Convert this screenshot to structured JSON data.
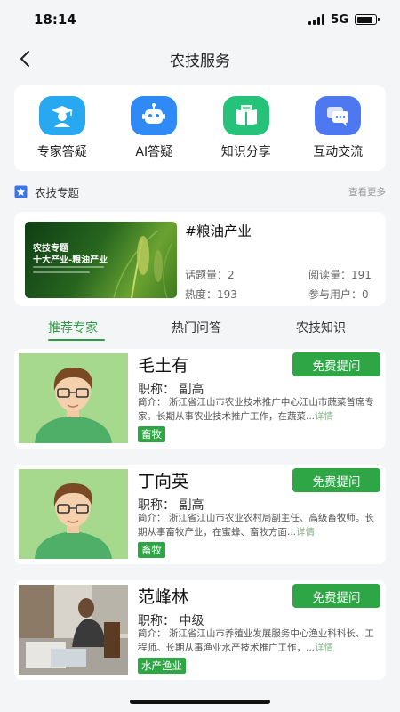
{
  "status_bar": {
    "time": "18:14",
    "network": "5G",
    "battery_level": 0.85
  },
  "nav": {
    "title": "农技服务"
  },
  "services": [
    {
      "label": "专家答疑",
      "icon": "expert-icon",
      "color": "#29a8f2"
    },
    {
      "label": "AI答疑",
      "icon": "robot-icon",
      "color": "#2f8af5"
    },
    {
      "label": "知识分享",
      "icon": "book-icon",
      "color": "#27c27a"
    },
    {
      "label": "互动交流",
      "icon": "chat-icon",
      "color": "#4e78f0"
    }
  ],
  "topics": {
    "title": "农技专题",
    "more": "查看更多",
    "card": {
      "banner_line1": "农技专题",
      "banner_line2": "十大产业-粮油产业",
      "name": "#粮油产业",
      "questions_label": "话题量：",
      "questions": "2",
      "reads_label": "阅读量：",
      "reads": "191",
      "heat_label": "热度：",
      "heat": "193",
      "users_label": "参与用户：",
      "users": "0"
    }
  },
  "tabs": [
    "推荐专家",
    "热门问答",
    "农技知识"
  ],
  "active_tab": 0,
  "ask_label": "免费提问",
  "title_label": "职称：",
  "intro_label": "简介：",
  "detail_label": "详情",
  "experts": [
    {
      "name": "毛土有",
      "title": "副高",
      "intro": "浙江省江山市农业技术推广中心江山市蔬菜首席专家。长期从事农业技术推广工作，在蔬菜...",
      "tag": "畜牧"
    },
    {
      "name": "丁向英",
      "title": "副高",
      "intro": "浙江省江山市农业农村局副主任、高级畜牧师。长期从事畜牧产业，在蜜蜂、畜牧方面...",
      "tag": "畜牧"
    },
    {
      "name": "范峰林",
      "title": "中级",
      "intro": "浙江省江山市养殖业发展服务中心渔业科科长、工程师。长期从事渔业水产技术推广工作，...",
      "tag": "水产渔业"
    }
  ],
  "colors": {
    "accent": "#2ea646",
    "tab_active": "#2e9b47",
    "avatar_bg": "#a6d88e"
  }
}
